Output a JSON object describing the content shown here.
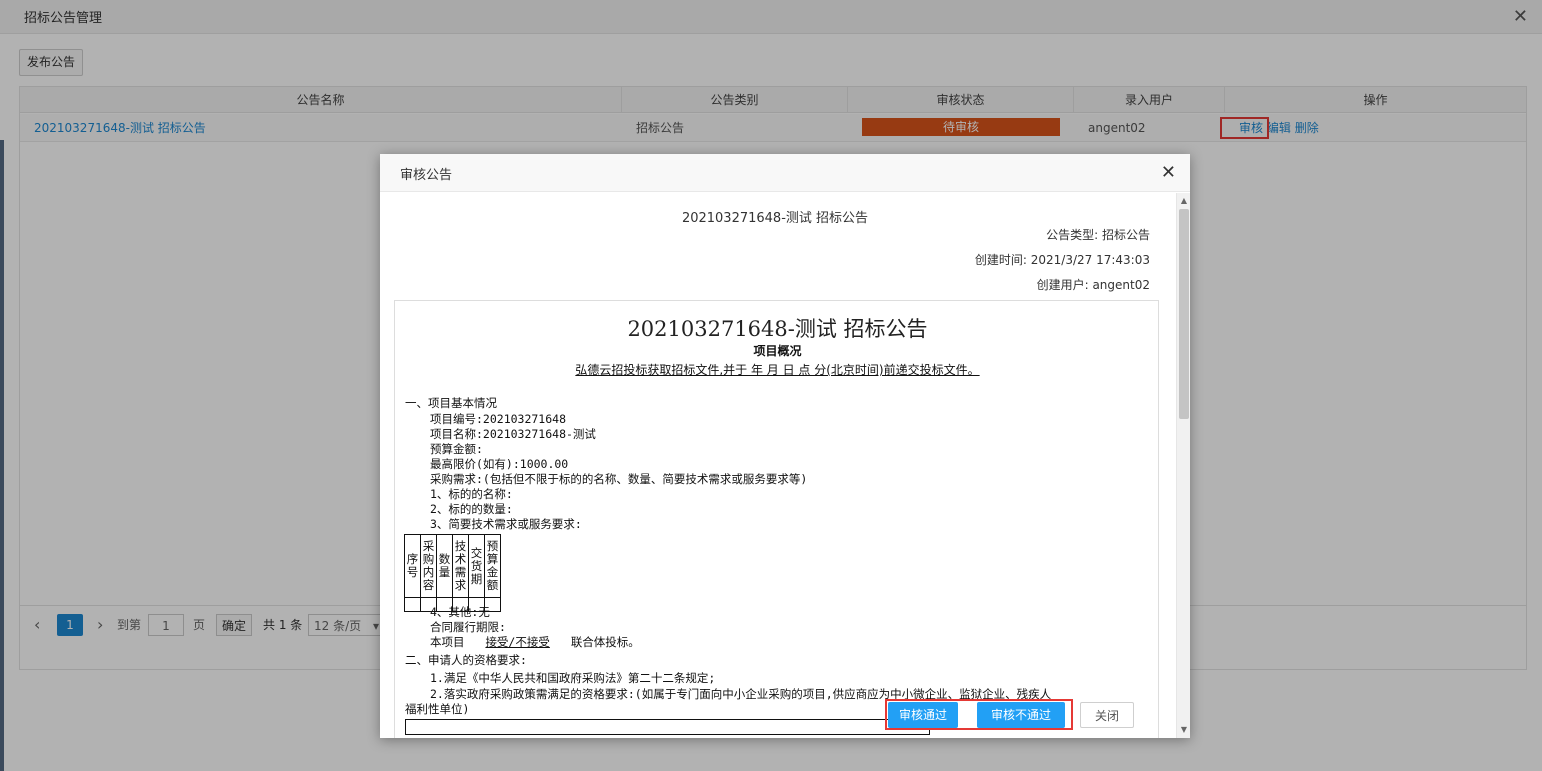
{
  "window": {
    "title": "招标公告管理",
    "close": "✕"
  },
  "toolbar": {
    "publish_label": "发布公告"
  },
  "grid": {
    "headers": [
      "公告名称",
      "公告类别",
      "审核状态",
      "录入用户",
      "操作"
    ],
    "row": {
      "name": "202103271648-测试 招标公告",
      "category": "招标公告",
      "status": "待审核",
      "user": "angent02",
      "ops": {
        "review": "审核",
        "edit": "编辑",
        "delete": "删除"
      }
    },
    "colors": {
      "status": "#d9541b",
      "link": "#1e88d2"
    }
  },
  "pager": {
    "prev": "‹",
    "page": "1",
    "next": "›",
    "goto": "到第",
    "page_input": "1",
    "page_unit": "页",
    "confirm": "确定",
    "total": "共 1 条",
    "page_size": "12 条/页",
    "dropdown": "▾"
  },
  "dialog": {
    "title": "审核公告",
    "close": "✕",
    "announcement_title": "202103271648-测试 招标公告",
    "meta": {
      "type_label": "公告类型:",
      "type_value": "招标公告",
      "created_label": "创建时间:",
      "created_value": "2021/3/27 17:43:03",
      "user_label": "创建用户:",
      "user_value": "angent02"
    },
    "doc": {
      "h1": "202103271648-测试 招标公告",
      "h2": "项目概况",
      "sub": "弘德云招投标获取招标文件,并于 年 月 日 点 分(北京时间)前递交投标文件。",
      "sec1": "一、项目基本情况",
      "code": "项目编号:202103271648",
      "pname": "项目名称:202103271648-测试",
      "budget": "预算金额:",
      "maxprice": "最高限价(如有):1000.00",
      "demand": "采购需求:(包括但不限于标的的名称、数量、简要技术需求或服务要求等)",
      "d1": "1、标的的名称:",
      "d2": "2、标的的数量:",
      "d3": "3、简要技术需求或服务要求:",
      "table_headers": [
        "序号",
        "采购内容",
        "数量",
        "技术需求",
        "交货期",
        "预算金额"
      ],
      "other": "4、其他:无",
      "period": "合同履行期限:",
      "consortium_pre": "本项目",
      "consortium_mid": "接受/不接受",
      "consortium_post": "联合体投标。",
      "sec2": "二、申请人的资格要求:",
      "q1": "1.满足《中华人民共和国政府采购法》第二十二条规定;",
      "q2": "2.落实政府采购政策需满足的资格要求:(如属于专门面向中小企业采购的项目,供应商应为中小微企业、监狱企业、残疾人",
      "q2b": "福利性单位)"
    },
    "buttons": {
      "pass": "审核通过",
      "fail": "审核不通过",
      "close": "关闭"
    }
  }
}
